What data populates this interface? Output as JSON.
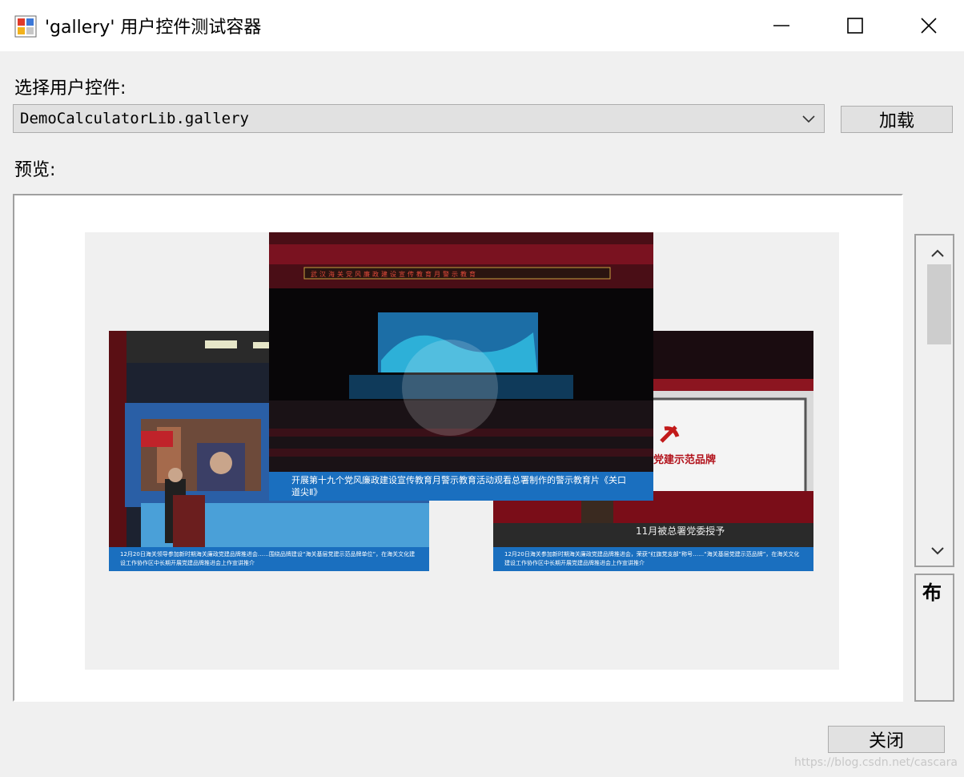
{
  "window": {
    "title": "'gallery' 用户控件测试容器"
  },
  "form": {
    "select_label": "选择用户控件:",
    "combo_value": "DemoCalculatorLib.gallery",
    "load_button": "加载",
    "preview_label": "预览:",
    "close_button": "关闭"
  },
  "gallery": {
    "center_caption": "开展第十九个党风廉政建设宣传教育月警示教育活动观看总署制作的警示教育片《关口道尖Ⅱ》",
    "center_banner": "武汉海关党风廉政建设宣传教育月警示教育",
    "left_caption": "12月20日海关领导参加新时期海关廉政党建品牌推进会……围绕品牌建设“海关基层党建示范品牌单位”，在海关文化建设工作协作区中长期开展党建品牌推进会上作宣讲推介",
    "right_caption": "12月20日海关参加新时期海关廉政党建品牌推进会，荣获“红旗党支部”称号……“海关基层党建示范品牌”，在海关文化建设工作协作区中长期开展党建品牌推进会上作宣讲推介",
    "right_cert_text": "党建示范品牌",
    "right_footer_text": "11月被总署党委授予"
  },
  "side_panel": {
    "text": "布"
  },
  "watermark": "https://blog.csdn.net/cascara",
  "colors": {
    "caption_blue": "#1a6fbf",
    "window_bg": "#f0f0f0"
  }
}
